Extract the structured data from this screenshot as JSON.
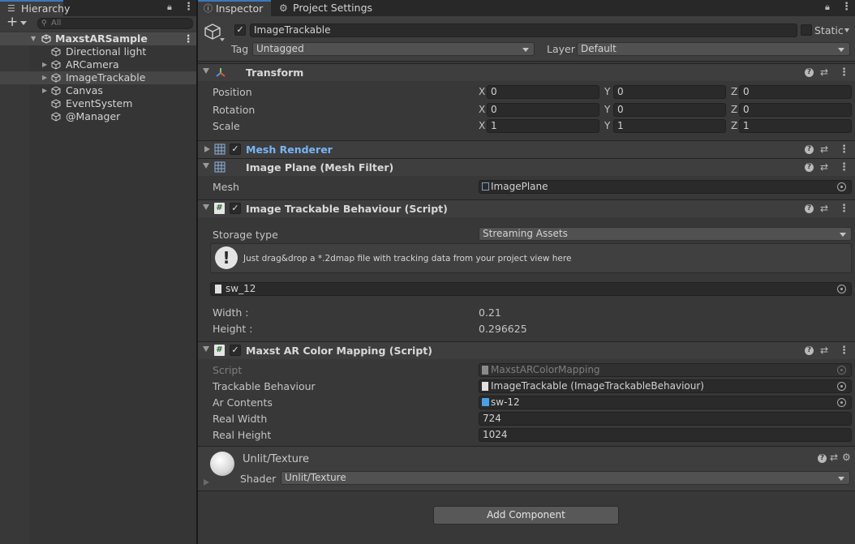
{
  "hierarchy": {
    "tab_label": "Hierarchy",
    "search_placeholder": "All",
    "scene_name": "MaxstARSample",
    "items": [
      {
        "label": "Directional light"
      },
      {
        "label": "ARCamera"
      },
      {
        "label": "ImageTrackable"
      },
      {
        "label": "Canvas"
      },
      {
        "label": "EventSystem"
      },
      {
        "label": "@Manager"
      }
    ]
  },
  "inspector": {
    "tabs": [
      "Inspector",
      "Project Settings"
    ],
    "object_name": "ImageTrackable",
    "static_label": "Static",
    "tag_label": "Tag",
    "tag_value": "Untagged",
    "layer_label": "Layer",
    "layer_value": "Default",
    "transform": {
      "title": "Transform",
      "rows": [
        {
          "label": "Position",
          "x": "0",
          "y": "0",
          "z": "0"
        },
        {
          "label": "Rotation",
          "x": "0",
          "y": "0",
          "z": "0"
        },
        {
          "label": "Scale",
          "x": "1",
          "y": "1",
          "z": "1"
        }
      ],
      "axis": [
        "X",
        "Y",
        "Z"
      ]
    },
    "mesh_renderer": {
      "title": "Mesh Renderer"
    },
    "mesh_filter": {
      "title": "Image Plane (Mesh Filter)",
      "mesh_label": "Mesh",
      "mesh_value": "ImagePlane"
    },
    "itb": {
      "title": "Image Trackable Behaviour (Script)",
      "storage_label": "Storage type",
      "storage_value": "Streaming Assets",
      "help_text": "Just drag&drop a *.2dmap file with tracking data from your project view here",
      "file_value": "sw_12",
      "width_label": "Width :",
      "width_value": "0.21",
      "height_label": "Height :",
      "height_value": "0.296625"
    },
    "color_mapping": {
      "title": "Maxst AR Color Mapping (Script)",
      "script_label": "Script",
      "script_value": "MaxstARColorMapping",
      "tb_label": "Trackable Behaviour",
      "tb_value": "ImageTrackable (ImageTrackableBehaviour)",
      "ar_label": "Ar Contents",
      "ar_value": "sw-12",
      "rw_label": "Real Width",
      "rw_value": "724",
      "rh_label": "Real Height",
      "rh_value": "1024"
    },
    "material": {
      "name": "Unlit/Texture",
      "shader_label": "Shader",
      "shader_value": "Unlit/Texture"
    },
    "add_component": "Add Component"
  },
  "colors": {
    "accent": "#3a79bb",
    "link": "#7ab4f5"
  }
}
